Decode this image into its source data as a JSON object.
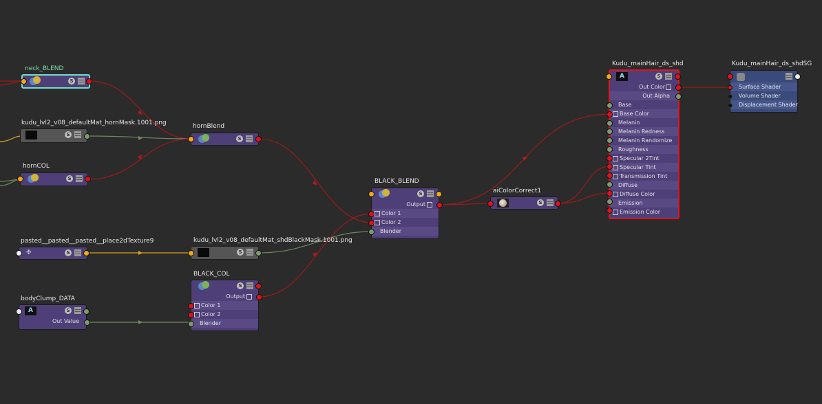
{
  "nodes": {
    "neck_blend": {
      "title": "neck_BLEND"
    },
    "horn_mask": {
      "title": "kudu_lvl2_v08_defaultMat_hornMask.1001.png"
    },
    "horn_blend": {
      "title": "hornBlend"
    },
    "horn_col": {
      "title": "hornCOL"
    },
    "place2d": {
      "title": "pasted__pasted__pasted__place2dTexture9"
    },
    "shd_black_mask": {
      "title": "kudu_lvl2_v08_defaultMat_shdBlackMask.1001.png"
    },
    "black_col": {
      "title": "BLACK_COL",
      "output": "Output",
      "color1": "Color 1",
      "color2": "Color 2",
      "blender": "Blender"
    },
    "body_clump": {
      "title": "bodyClump_DATA",
      "out_value": "Out Value"
    },
    "black_blend": {
      "title": "BLACK_BLEND",
      "output": "Output",
      "color1": "Color 1",
      "color2": "Color 2",
      "blender": "Blender"
    },
    "ai_color_correct": {
      "title": "aiColorCorrect1"
    },
    "main_hair": {
      "title": "Kudu_mainHair_ds_shd",
      "out_color": "Out Color",
      "out_alpha": "Out Alpha",
      "attrs": [
        "Base",
        "Base Color",
        "Melanin",
        "Melanin Redness",
        "Melanin Randomize",
        "Roughness",
        "Specular 2Tint",
        "Specular Tint",
        "Transmission Tint",
        "Diffuse",
        "Diffuse Color",
        "Emission",
        "Emission Color"
      ]
    },
    "shading_group": {
      "title": "Kudu_mainHair_ds_shdSG",
      "attrs": [
        "Surface Shader",
        "Volume Shader",
        "Displacement Shader"
      ]
    }
  },
  "icons": {
    "swatch": "S",
    "arnold": "A"
  },
  "colors": {
    "background": "#2b2b2b",
    "node_purple": "#4e3f78",
    "wire_red": "#9c1a1a",
    "wire_green": "#6f8a5c",
    "wire_yellow": "#d9a21c",
    "selection_red": "#e0141e",
    "selection_cyan": "#6fe0c8"
  }
}
